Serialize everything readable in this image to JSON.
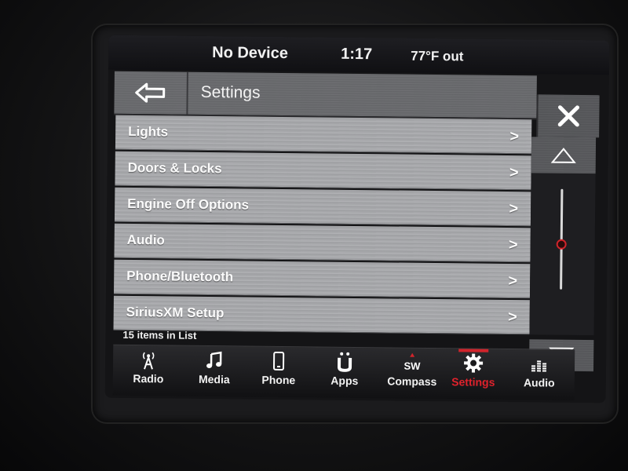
{
  "status": {
    "device": "No Device",
    "time": "1:17",
    "temperature": "77°F out"
  },
  "header": {
    "title": "Settings"
  },
  "list": {
    "items": [
      {
        "label": "Lights"
      },
      {
        "label": "Doors & Locks"
      },
      {
        "label": "Engine Off Options"
      },
      {
        "label": "Audio"
      },
      {
        "label": "Phone/Bluetooth"
      },
      {
        "label": "SiriusXM Setup"
      }
    ],
    "count_text": "15 items in List",
    "scroll_fraction": 0.55
  },
  "nav": {
    "items": [
      {
        "label": "Radio",
        "icon": "radio-tower-icon"
      },
      {
        "label": "Media",
        "icon": "music-note-icon"
      },
      {
        "label": "Phone",
        "icon": "phone-icon"
      },
      {
        "label": "Apps",
        "icon": "apps-icon"
      },
      {
        "label": "Compass",
        "icon": "compass-sw-icon",
        "badge": "SW"
      },
      {
        "label": "Settings",
        "icon": "gear-icon"
      },
      {
        "label": "Audio",
        "icon": "equalizer-icon"
      }
    ],
    "active": "Settings"
  },
  "colors": {
    "accent": "#d1242b",
    "list_row": "#a9aaad",
    "text": "#f4f4f4"
  }
}
